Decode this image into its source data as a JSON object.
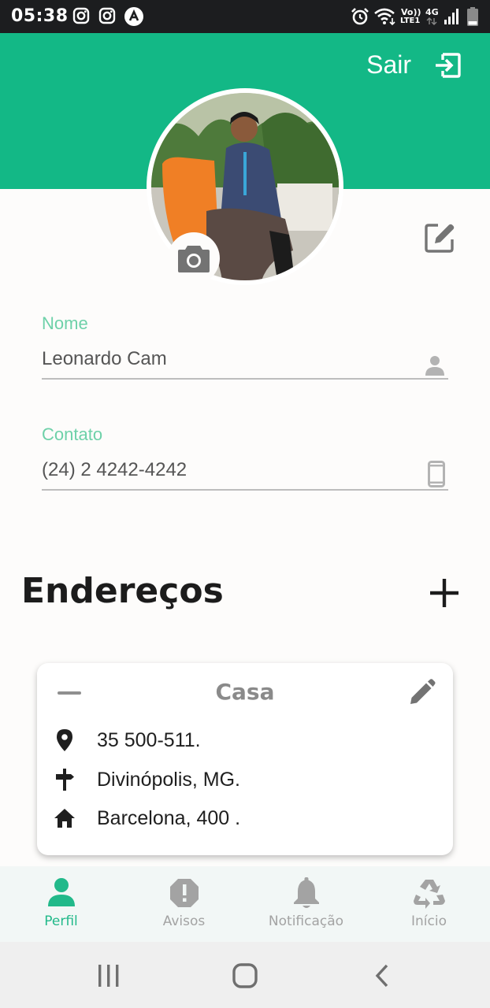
{
  "status_bar": {
    "time": "05:38",
    "volte": "Vo))",
    "lte": "LTE1",
    "network": "4G",
    "icons": [
      "instagram-icon",
      "instagram-icon",
      "arrow-app-icon",
      "alarm-icon",
      "wifi-icon",
      "signal-icon",
      "battery-icon"
    ]
  },
  "header": {
    "logout_label": "Sair",
    "brand_color": "#13b886"
  },
  "profile": {
    "name_label": "Nome",
    "name_value": "Leonardo Cam",
    "contact_label": "Contato",
    "contact_value": "(24) 2 4242-4242"
  },
  "addresses": {
    "title": "Endereços",
    "cards": [
      {
        "title": "Casa",
        "cep": "35 500-511.",
        "city": "Divinópolis, MG.",
        "street": "Barcelona, 400 ."
      }
    ]
  },
  "bottom_nav": {
    "items": [
      {
        "label": "Perfil",
        "icon": "person-icon",
        "active": true
      },
      {
        "label": "Avisos",
        "icon": "alert-octagon-icon",
        "active": false
      },
      {
        "label": "Notificação",
        "icon": "bell-icon",
        "active": false
      },
      {
        "label": "Início",
        "icon": "recycle-icon",
        "active": false
      }
    ],
    "active_color": "#22b98a",
    "inactive_color": "#a3a3a3"
  }
}
